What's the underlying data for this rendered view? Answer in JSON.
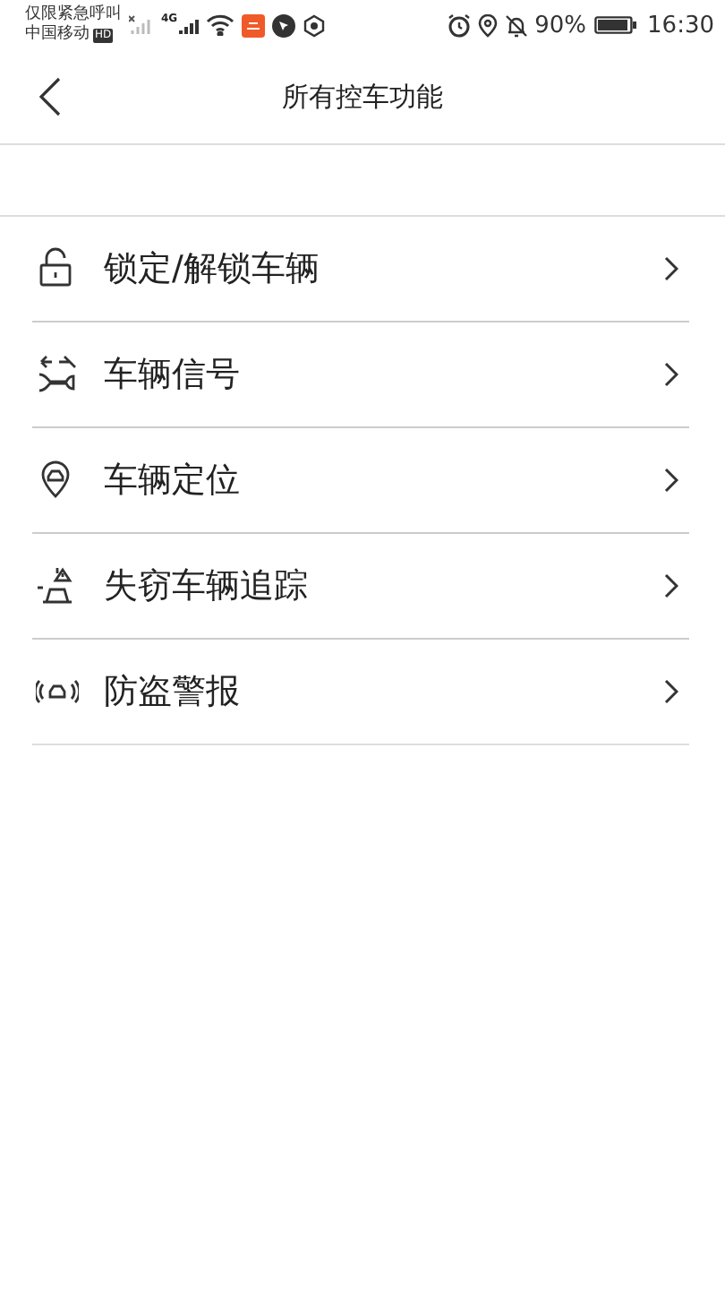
{
  "status_bar": {
    "carrier_top": "仅限紧急呼叫",
    "carrier_bottom": "中国移动",
    "hd_badge": "HD",
    "network": "4G",
    "battery": "90%",
    "time": "16:30"
  },
  "header": {
    "title": "所有控车功能"
  },
  "items": [
    {
      "label": "锁定/解锁车辆",
      "kind": "lock"
    },
    {
      "label": "车辆信号",
      "kind": "signal"
    },
    {
      "label": "车辆定位",
      "kind": "locate"
    },
    {
      "label": "失窃车辆追踪",
      "kind": "track"
    },
    {
      "label": "防盗警报",
      "kind": "alarm"
    }
  ]
}
